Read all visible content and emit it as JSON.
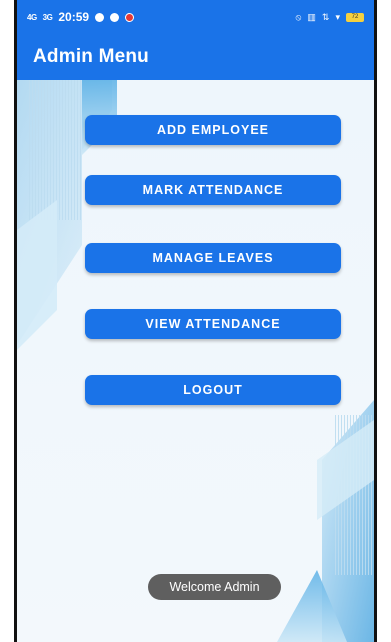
{
  "status_bar": {
    "signal_1": "4G",
    "signal_2": "3G",
    "time": "20:59",
    "battery": "72"
  },
  "app_bar": {
    "title": "Admin Menu"
  },
  "menu": {
    "buttons": [
      "ADD EMPLOYEE",
      "MARK ATTENDANCE",
      "MANAGE LEAVES",
      "VIEW ATTENDANCE",
      "LOGOUT"
    ]
  },
  "toast": {
    "message": "Welcome Admin"
  },
  "colors": {
    "primary": "#1a73e8",
    "background": "#e9f3fb",
    "toast": "#5f5f5f"
  }
}
